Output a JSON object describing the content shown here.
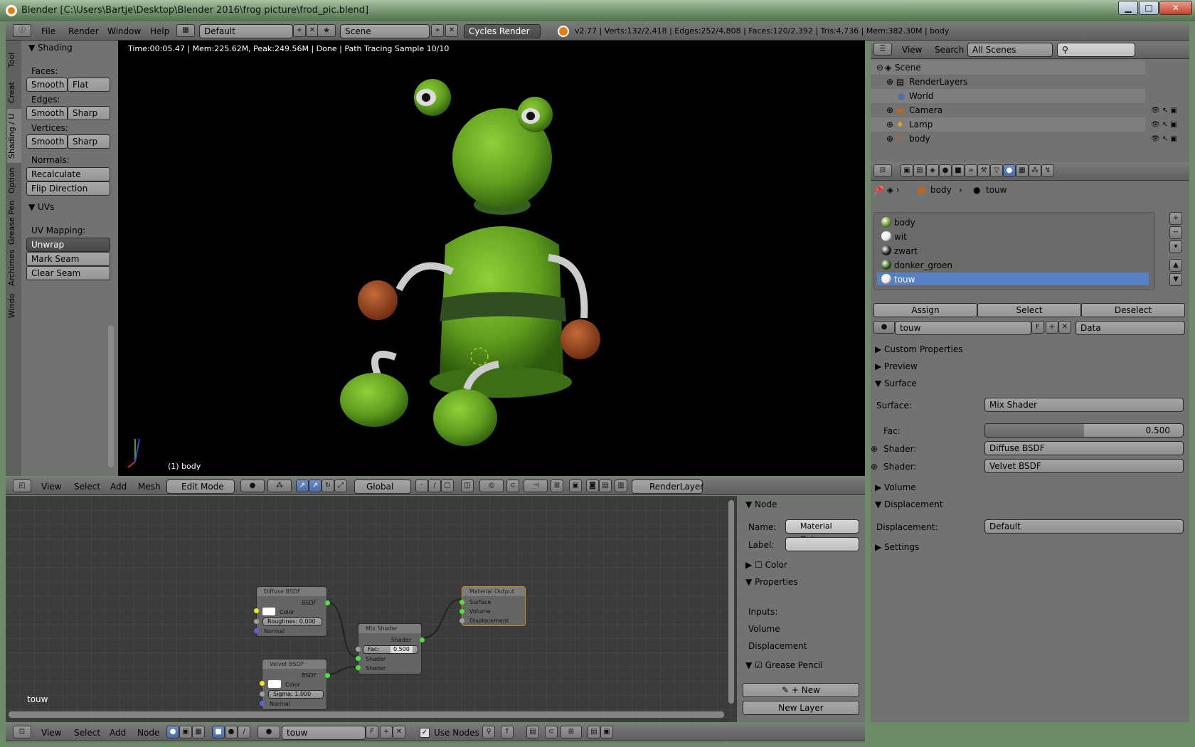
{
  "window": {
    "title": "Blender  [C:\\Users\\Bartje\\Desktop\\Blender 2016\\frog picture\\frod_pic.blend]",
    "minimize": "▁",
    "maximize": "□",
    "close": "✕"
  },
  "topbar": {
    "menus": [
      "File",
      "Render",
      "Window",
      "Help"
    ],
    "layout": "Default",
    "scene": "Scene",
    "engine": "Cycles Render",
    "stats": "v2.77 | Verts:132/2,418 | Edges:252/4,808 | Faces:120/2,392 | Tris:4,736 | Mem:382.30M | body"
  },
  "tools": {
    "tabs": [
      "Tool",
      "Creat",
      "Shading / U",
      "Option",
      "Grease Pen",
      "Archimes",
      "Windo"
    ],
    "shading_title": "Shading",
    "faces_label": "Faces:",
    "edges_label": "Edges:",
    "vertices_label": "Vertices:",
    "normals_label": "Normals:",
    "smooth": "Smooth",
    "flat": "Flat",
    "sharp": "Sharp",
    "recalculate": "Recalculate",
    "flip": "Flip Direction",
    "uvs_title": "UVs",
    "uv_mapping": "UV Mapping:",
    "unwrap": "Unwrap",
    "mark_seam": "Mark Seam",
    "clear_seam": "Clear Seam"
  },
  "viewport": {
    "render_info": "Time:00:05.47 | Mem:225.62M, Peak:249.56M | Done | Path Tracing Sample 10/10",
    "object_label": "(1) body",
    "header_menus": [
      "View",
      "Select",
      "Add",
      "Mesh"
    ],
    "mode": "Edit Mode",
    "orientation": "Global",
    "render_layer": "RenderLayer"
  },
  "outliner": {
    "view": "View",
    "search": "Search",
    "scenes": "All Scenes",
    "items": [
      "Scene",
      "RenderLayers",
      "World",
      "Camera",
      "Lamp",
      "body"
    ]
  },
  "properties": {
    "breadcrumb_obj": "body",
    "breadcrumb_mat": "touw",
    "materials": [
      "body",
      "wit",
      "zwart",
      "donker_groen",
      "touw"
    ],
    "material_colors": [
      "#6a9a2a",
      "#e8e8e8",
      "#222222",
      "#2d5a18",
      "#e8e8e8"
    ],
    "assign": "Assign",
    "select": "Select",
    "deselect": "Deselect",
    "mat_name": "touw",
    "fake": "F",
    "data": "Data",
    "custom_props": "Custom Properties",
    "preview": "Preview",
    "surface_title": "Surface",
    "surface_label": "Surface:",
    "surface_value": "Mix Shader",
    "fac_label": "Fac:",
    "fac_value": "0.500",
    "fac_fraction": 0.5,
    "shader_label": "Shader:",
    "shader1": "Diffuse BSDF",
    "shader2": "Velvet BSDF",
    "volume": "Volume",
    "displacement_title": "Displacement",
    "displacement_label": "Displacement:",
    "displacement_value": "Default",
    "settings": "Settings"
  },
  "nodes": {
    "diffuse": {
      "title": "Diffuse BSDF",
      "bsdf": "BSDF",
      "color": "Color",
      "roughness": "Roughnes: 0.000",
      "normal": "Normal"
    },
    "velvet": {
      "title": "Velvet BSDF",
      "bsdf": "BSDF",
      "color": "Color",
      "sigma_label": "Sigma:",
      "sigma": "1.000",
      "normal": "Normal"
    },
    "mix": {
      "title": "Mix Shader",
      "shader_out": "Shader",
      "fac_label": "Fac:",
      "fac": "0.500",
      "shader1": "Shader",
      "shader2": "Shader"
    },
    "output": {
      "title": "Material Output",
      "surface": "Surface",
      "volume": "Volume",
      "displacement": "Displacement"
    },
    "material_name": "touw",
    "header_menus": [
      "View",
      "Select",
      "Add",
      "Node"
    ],
    "header_mat": "touw",
    "header_f": "F",
    "use_nodes": "Use Nodes"
  },
  "node_sidebar": {
    "node_title": "Node",
    "name_label": "Name:",
    "name_value": "Material Outp...",
    "label_label": "Label:",
    "color": "Color",
    "properties": "Properties",
    "inputs": "Inputs:",
    "volume": "Volume",
    "displacement": "Displacement",
    "grease_pencil": "Grease Pencil",
    "new": "New",
    "new_layer": "New Layer"
  }
}
